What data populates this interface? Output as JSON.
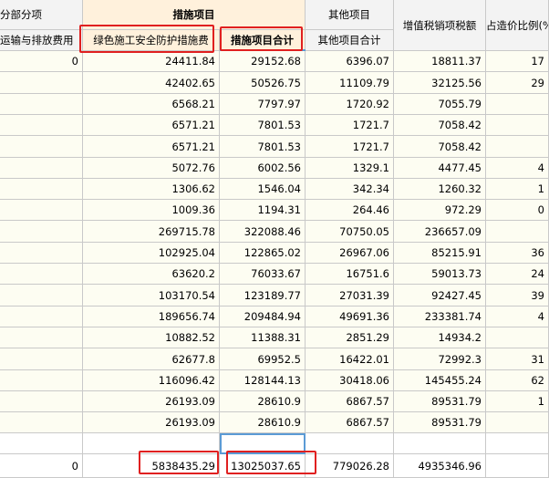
{
  "header": {
    "col_a_top": "分部分项",
    "col_a_bottom": "运输与排放费用",
    "group_measures": "措施项目",
    "col_b": "绿色施工安全防护措施费",
    "col_c": "措施项目合计",
    "col_d_top": "其他项目",
    "col_d_bottom": "其他项目合计",
    "col_e": "增值税销项税额",
    "col_f": "占造价比例(%"
  },
  "rows": [
    {
      "a": "0",
      "b": "24411.84",
      "c": "29152.68",
      "d": "6396.07",
      "e": "18811.37",
      "f": "17"
    },
    {
      "a": "",
      "b": "42402.65",
      "c": "50526.75",
      "d": "11109.79",
      "e": "32125.56",
      "f": "29"
    },
    {
      "a": "",
      "b": "6568.21",
      "c": "7797.97",
      "d": "1720.92",
      "e": "7055.79",
      "f": ""
    },
    {
      "a": "",
      "b": "6571.21",
      "c": "7801.53",
      "d": "1721.7",
      "e": "7058.42",
      "f": ""
    },
    {
      "a": "",
      "b": "6571.21",
      "c": "7801.53",
      "d": "1721.7",
      "e": "7058.42",
      "f": ""
    },
    {
      "a": "",
      "b": "5072.76",
      "c": "6002.56",
      "d": "1329.1",
      "e": "4477.45",
      "f": "4"
    },
    {
      "a": "",
      "b": "1306.62",
      "c": "1546.04",
      "d": "342.34",
      "e": "1260.32",
      "f": "1"
    },
    {
      "a": "",
      "b": "1009.36",
      "c": "1194.31",
      "d": "264.46",
      "e": "972.29",
      "f": "0"
    },
    {
      "a": "",
      "b": "269715.78",
      "c": "322088.46",
      "d": "70750.05",
      "e": "236657.09",
      "f": ""
    },
    {
      "a": "",
      "b": "102925.04",
      "c": "122865.02",
      "d": "26967.06",
      "e": "85215.91",
      "f": "36"
    },
    {
      "a": "",
      "b": "63620.2",
      "c": "76033.67",
      "d": "16751.6",
      "e": "59013.73",
      "f": "24"
    },
    {
      "a": "",
      "b": "103170.54",
      "c": "123189.77",
      "d": "27031.39",
      "e": "92427.45",
      "f": "39"
    },
    {
      "a": "",
      "b": "189656.74",
      "c": "209484.94",
      "d": "49691.36",
      "e": "233381.74",
      "f": "4"
    },
    {
      "a": "",
      "b": "10882.52",
      "c": "11388.31",
      "d": "2851.29",
      "e": "14934.2",
      "f": ""
    },
    {
      "a": "",
      "b": "62677.8",
      "c": "69952.5",
      "d": "16422.01",
      "e": "72992.3",
      "f": "31"
    },
    {
      "a": "",
      "b": "116096.42",
      "c": "128144.13",
      "d": "30418.06",
      "e": "145455.24",
      "f": "62"
    },
    {
      "a": "",
      "b": "26193.09",
      "c": "28610.9",
      "d": "6867.57",
      "e": "89531.79",
      "f": "1"
    },
    {
      "a": "",
      "b": "26193.09",
      "c": "28610.9",
      "d": "6867.57",
      "e": "89531.79",
      "f": ""
    }
  ],
  "total_row": {
    "a": "0",
    "b": "5838435.29",
    "c": "13025037.65",
    "d": "779026.28",
    "e": "4935346.96",
    "f": ""
  },
  "colors": {
    "highlight_box": "#e02020",
    "selection": "#5b9bd5",
    "header_bg": "#f3f3f3",
    "measures_bg": "#fff1dc",
    "row_bg": "#fdfdf2"
  }
}
